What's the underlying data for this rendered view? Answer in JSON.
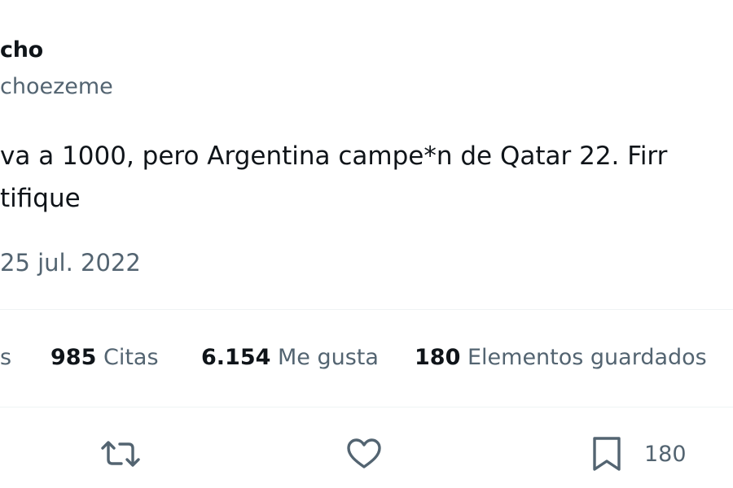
{
  "tweet": {
    "author_name": "cho",
    "author_handle": "choezeme",
    "text_line_1": "va a 1000, pero Argentina campe*n de Qatar 22. Firr",
    "text_line_2": "tifique",
    "date": "25 jul. 2022"
  },
  "stats": {
    "partial_label": "s",
    "quotes_count": "985",
    "quotes_label": "Citas",
    "likes_count": "6.154",
    "likes_label": "Me gusta",
    "bookmarks_count": "180",
    "bookmarks_label": "Elementos guardados"
  },
  "actions": {
    "retweet_icon": "retweet-icon",
    "like_icon": "heart-icon",
    "bookmark_icon": "bookmark-icon",
    "bookmark_count": "180"
  },
  "colors": {
    "primary_text": "#0f1419",
    "secondary_text": "#536471",
    "divider": "#eff3f4"
  }
}
